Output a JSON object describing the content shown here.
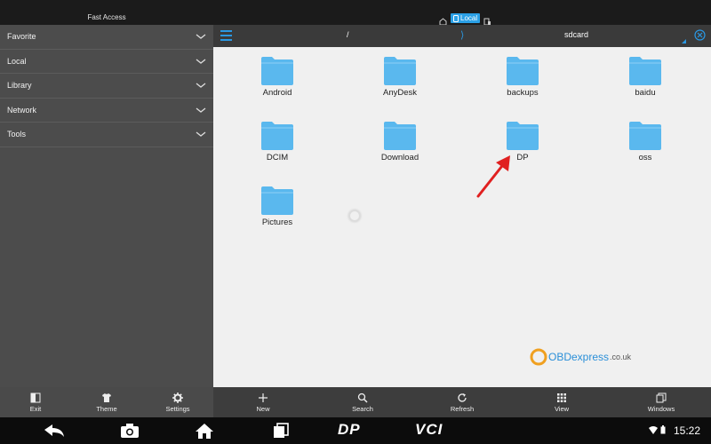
{
  "top": {
    "fast_access_title": "Fast Access",
    "tabs": {
      "local_label": "Local"
    }
  },
  "sidebar": {
    "items": [
      {
        "label": "Favorite"
      },
      {
        "label": "Local"
      },
      {
        "label": "Library"
      },
      {
        "label": "Network"
      },
      {
        "label": "Tools"
      }
    ]
  },
  "pathbar": {
    "root": "/",
    "separator": "⟩",
    "current": "sdcard"
  },
  "folders": [
    {
      "name": "Android"
    },
    {
      "name": "AnyDesk"
    },
    {
      "name": "backups"
    },
    {
      "name": "baidu"
    },
    {
      "name": "DCIM"
    },
    {
      "name": "Download"
    },
    {
      "name": "DP"
    },
    {
      "name": "oss"
    },
    {
      "name": "Pictures"
    }
  ],
  "watermark": {
    "text": "OBDexpress",
    "suffix": ".co.uk"
  },
  "toolbar_left": [
    {
      "label": "Exit",
      "icon": "exit-icon"
    },
    {
      "label": "Theme",
      "icon": "shirt-icon"
    },
    {
      "label": "Settings",
      "icon": "gear-icon"
    }
  ],
  "toolbar_right": [
    {
      "label": "New",
      "icon": "plus-icon"
    },
    {
      "label": "Search",
      "icon": "search-icon"
    },
    {
      "label": "Refresh",
      "icon": "refresh-icon"
    },
    {
      "label": "View",
      "icon": "grid-icon"
    },
    {
      "label": "Windows",
      "icon": "windows-icon"
    }
  ],
  "navbar": {
    "dp_label": "DP",
    "vci_label": "VCI",
    "time": "15:22"
  },
  "colors": {
    "accent": "#2a98e3",
    "folder": "#5ab8ee",
    "sidebar_bg": "#4c4c4c",
    "files_bg": "#f0f0f0",
    "arrow": "#e02020"
  }
}
